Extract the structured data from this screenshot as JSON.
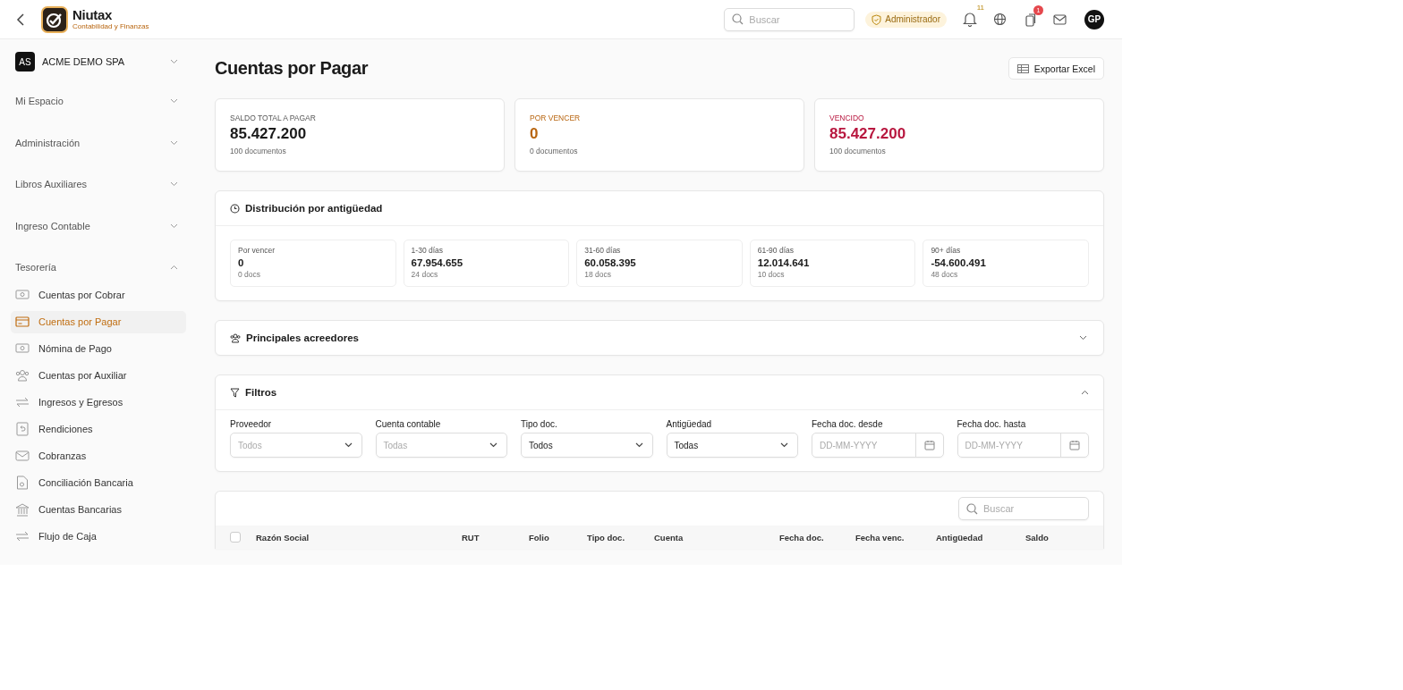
{
  "header": {
    "brand": "Niutax",
    "tagline": "Contabilidad y Finanzas",
    "search": {
      "placeholder": "Buscar"
    },
    "role": "Administrador",
    "notifications": "11",
    "tasks": "1",
    "avatar": "GP"
  },
  "company": {
    "initials": "AS",
    "name": "ACME DEMO SPA"
  },
  "sidebar": {
    "sections": [
      {
        "label": "Mi Espacio",
        "expanded": false
      },
      {
        "label": "Administración",
        "expanded": false
      },
      {
        "label": "Libros Auxiliares",
        "expanded": false
      },
      {
        "label": "Ingreso Contable",
        "expanded": false
      },
      {
        "label": "Tesorería",
        "expanded": true,
        "items": [
          {
            "label": "Cuentas por Cobrar",
            "selected": false
          },
          {
            "label": "Cuentas por Pagar",
            "selected": true
          },
          {
            "label": "Nómina de Pago",
            "selected": false
          },
          {
            "label": "Cuentas por Auxiliar",
            "selected": false
          },
          {
            "label": "Ingresos y Egresos",
            "selected": false
          },
          {
            "label": "Rendiciones",
            "selected": false
          },
          {
            "label": "Cobranzas",
            "selected": false
          },
          {
            "label": "Conciliación Bancaria",
            "selected": false
          },
          {
            "label": "Cuentas Bancarias",
            "selected": false
          },
          {
            "label": "Flujo de Caja",
            "selected": false
          }
        ]
      }
    ]
  },
  "page": {
    "title": "Cuentas por Pagar",
    "export_button": "Exportar Excel"
  },
  "summary": [
    {
      "label": "SALDO TOTAL A PAGAR",
      "value": "85.427.200",
      "count": "100 documentos",
      "color": "#1a1a1a"
    },
    {
      "label": "POR VENCER",
      "value": "0",
      "count": "0 documentos",
      "color": "#b8650f"
    },
    {
      "label": "VENCIDO",
      "value": "85.427.200",
      "count": "100 documentos",
      "color": "#b8173f"
    }
  ],
  "aging": {
    "title": "Distribución por antigüedad",
    "buckets": [
      {
        "label": "Por vencer",
        "value": "0",
        "count": "0 docs"
      },
      {
        "label": "1-30 días",
        "value": "67.954.655",
        "count": "24 docs"
      },
      {
        "label": "31-60 días",
        "value": "60.058.395",
        "count": "18 docs"
      },
      {
        "label": "61-90 días",
        "value": "12.014.641",
        "count": "10 docs"
      },
      {
        "label": "90+ días",
        "value": "-54.600.491",
        "count": "48 docs"
      }
    ]
  },
  "creditors": {
    "title": "Principales acreedores",
    "expanded": false
  },
  "filters": {
    "title": "Filtros",
    "expanded": true,
    "fields": [
      {
        "label": "Proveedor",
        "kind": "select",
        "placeholder": "Todos"
      },
      {
        "label": "Cuenta contable",
        "kind": "select",
        "placeholder": "Todas"
      },
      {
        "label": "Tipo doc.",
        "kind": "select",
        "value": "Todos"
      },
      {
        "label": "Antigüedad",
        "kind": "select",
        "value": "Todas"
      },
      {
        "label": "Fecha doc. desde",
        "kind": "date",
        "placeholder": "DD-MM-YYYY"
      },
      {
        "label": "Fecha doc. hasta",
        "kind": "date",
        "placeholder": "DD-MM-YYYY"
      }
    ]
  },
  "table": {
    "search": {
      "placeholder": "Buscar"
    },
    "select_all": false,
    "columns": [
      "Razón Social",
      "RUT",
      "Folio",
      "Tipo doc.",
      "Cuenta",
      "Fecha doc.",
      "Fecha venc.",
      "Antigüedad",
      "Saldo"
    ]
  }
}
